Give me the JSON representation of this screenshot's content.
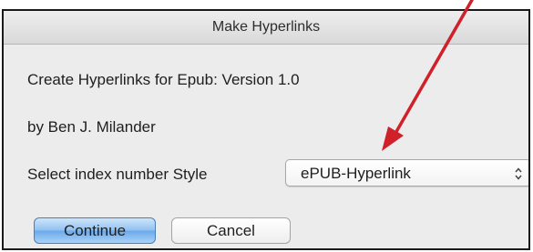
{
  "window": {
    "title": "Make Hyperlinks"
  },
  "content": {
    "line1": "Create Hyperlinks for Epub:  Version 1.0",
    "line2": "by Ben J. Milander",
    "select_label": "Select index number Style"
  },
  "select": {
    "value": "ePUB-Hyperlink"
  },
  "buttons": {
    "continue_label": "Continue",
    "cancel_label": "Cancel"
  },
  "colors": {
    "annotation_arrow": "#d0202a",
    "primary_button": "#6aa9ea"
  },
  "icons": {
    "select_arrows": "up-down-chevron-icon",
    "annotation": "red-arrow-icon"
  }
}
